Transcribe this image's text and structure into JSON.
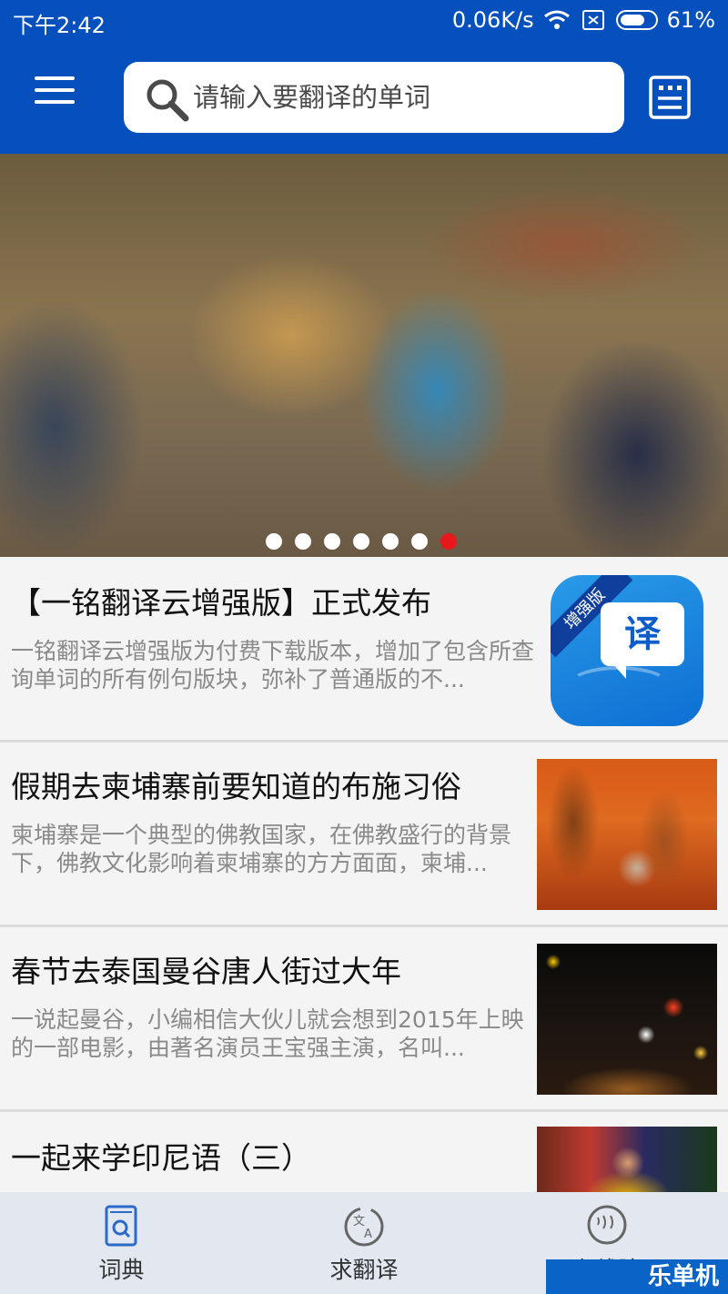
{
  "status_bar": {
    "time": "下午2:42",
    "network_speed": "0.06K/s",
    "battery": "61%"
  },
  "header": {
    "search_placeholder": "请输入要翻译的单词",
    "menu_icon": "hamburger-menu-icon",
    "vocab_icon": "vocabulary-notebook-icon"
  },
  "banner": {
    "dot_count": 7,
    "active_index": 6
  },
  "articles": [
    {
      "title": "【一铭翻译云增强版】正式发布",
      "summary": "一铭翻译云增强版为付费下载版本，增加了包含所查询单词的所有例句版块，弥补了普通版的不...",
      "logo_ribbon": "增强版",
      "logo_glyph": "译"
    },
    {
      "title": "假期去柬埔寨前要知道的布施习俗",
      "summary": "柬埔寨是一个典型的佛教国家，在佛教盛行的背景下，佛教文化影响着柬埔寨的方方面面，柬埔..."
    },
    {
      "title": "春节去泰国曼谷唐人街过大年",
      "summary": "一说起曼谷，小编相信大伙儿就会想到2015年上映的一部电影，由著名演员王宝强主演，名叫..."
    },
    {
      "title": "一起来学印尼语（三）",
      "summary": ""
    }
  ],
  "bottom_nav": {
    "items": [
      {
        "label": "词典",
        "icon": "dictionary-book-icon"
      },
      {
        "label": "求翻译",
        "icon": "translate-request-icon"
      },
      {
        "label": "在线陪",
        "icon": "online-chat-icon"
      }
    ]
  },
  "watermark": "乐单机",
  "colors": {
    "primary": "#0550bc",
    "dot_active": "#e8171b",
    "nav_bg": "#e3e8f0"
  }
}
